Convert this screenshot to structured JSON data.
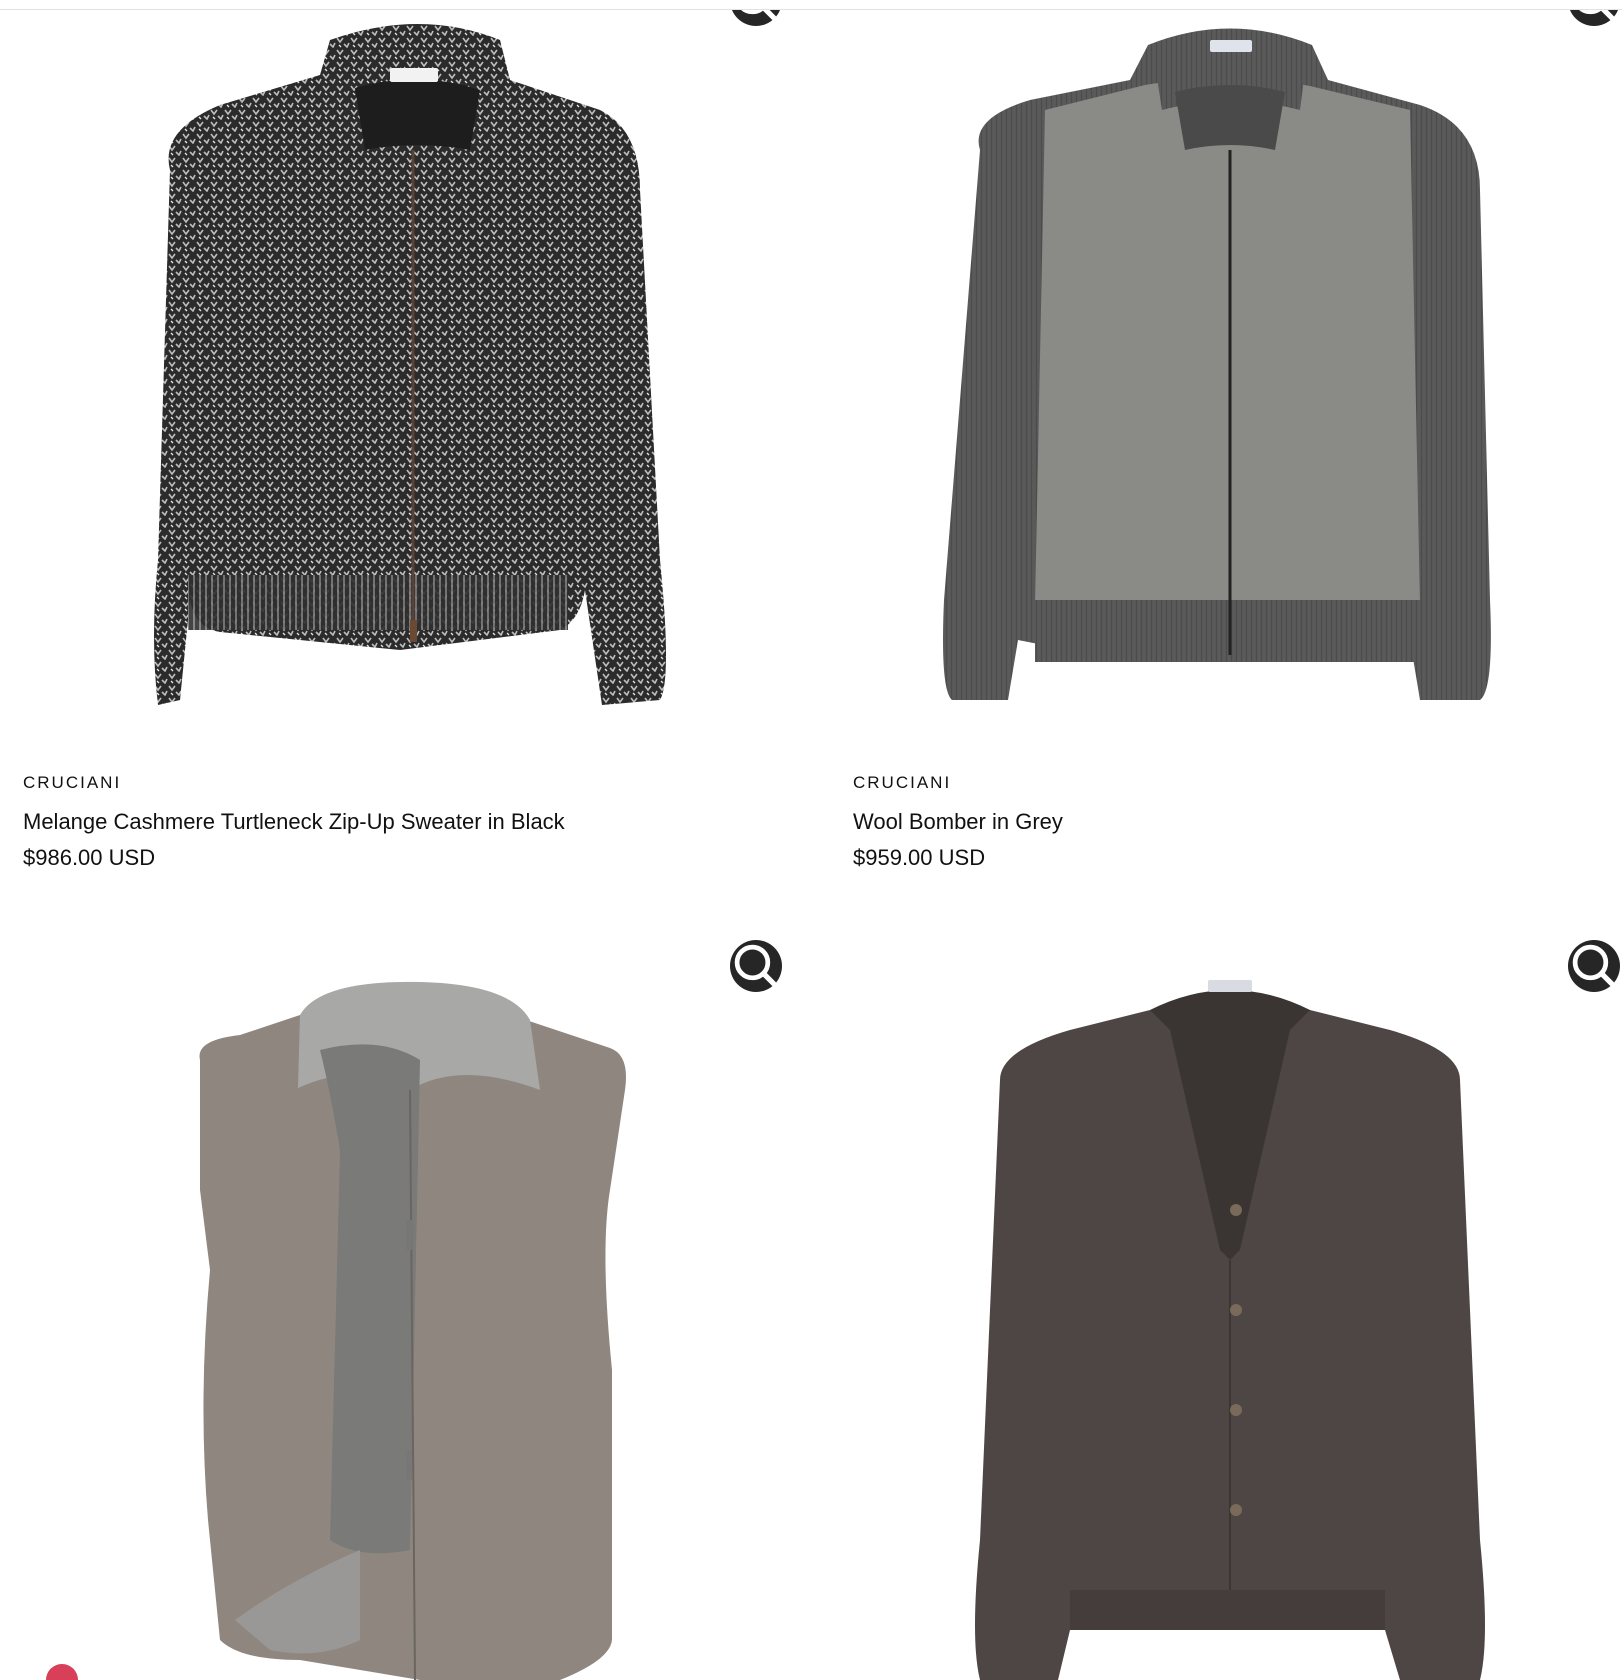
{
  "products": [
    {
      "brand": "CRUCIANI",
      "title": "Melange Cashmere Turtleneck Zip-Up Sweater in Black",
      "price": "$986.00 USD",
      "image": "black-melange-zip-sweater",
      "quick_view_icon": "search-icon"
    },
    {
      "brand": "CRUCIANI",
      "title": "Wool Bomber in Grey",
      "price": "$959.00 USD",
      "image": "grey-wool-bomber",
      "quick_view_icon": "search-icon"
    },
    {
      "brand": "",
      "title": "",
      "price": "",
      "image": "taupe-reversible-vest",
      "quick_view_icon": "search-icon"
    },
    {
      "brand": "",
      "title": "",
      "price": "",
      "image": "brown-ribbed-cardigan",
      "quick_view_icon": "search-icon"
    }
  ],
  "colors": {
    "zoom_button": "#262626",
    "badge": "#d8405a",
    "text": "#111111"
  }
}
